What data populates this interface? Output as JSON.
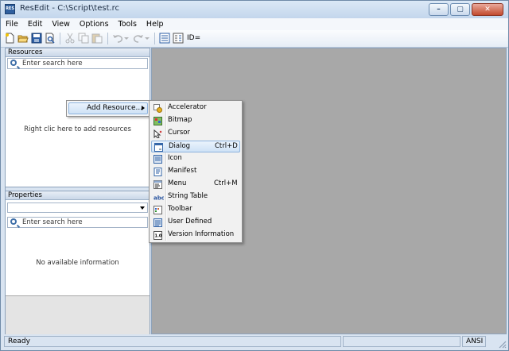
{
  "window": {
    "title": "ResEdit - C:\\Script\\test.rc",
    "app_icon_text": "RES"
  },
  "caption_buttons": {
    "minimize": "–",
    "maximize": "▢",
    "close": "✕"
  },
  "menubar": [
    "File",
    "Edit",
    "View",
    "Options",
    "Tools",
    "Help"
  ],
  "toolbar": {
    "id_label": "ID="
  },
  "resources_pane": {
    "header": "Resources",
    "search_placeholder": "Enter search here",
    "hint": "Right clic here to add resources"
  },
  "properties_pane": {
    "header": "Properties",
    "search_placeholder": "Enter search here",
    "empty_text": "No available information"
  },
  "context_menu": {
    "add_resource": "Add Resource..."
  },
  "submenu": [
    {
      "label": "Accelerator",
      "shortcut": "",
      "icon": "accelerator-icon"
    },
    {
      "label": "Bitmap",
      "shortcut": "",
      "icon": "bitmap-icon"
    },
    {
      "label": "Cursor",
      "shortcut": "",
      "icon": "cursor-icon"
    },
    {
      "label": "Dialog",
      "shortcut": "Ctrl+D",
      "icon": "dialog-icon",
      "highlighted": true
    },
    {
      "label": "Icon",
      "shortcut": "",
      "icon": "icon-resource-icon"
    },
    {
      "label": "Manifest",
      "shortcut": "",
      "icon": "manifest-icon"
    },
    {
      "label": "Menu",
      "shortcut": "Ctrl+M",
      "icon": "menu-icon"
    },
    {
      "label": "String Table",
      "shortcut": "",
      "icon": "string-table-icon",
      "icon_text": "abc"
    },
    {
      "label": "Toolbar",
      "shortcut": "",
      "icon": "toolbar-icon"
    },
    {
      "label": "User Defined",
      "shortcut": "",
      "icon": "user-defined-icon"
    },
    {
      "label": "Version Information",
      "shortcut": "",
      "icon": "version-info-icon",
      "icon_text": "1.0"
    }
  ],
  "statusbar": {
    "status": "Ready",
    "encoding": "ANSI"
  }
}
